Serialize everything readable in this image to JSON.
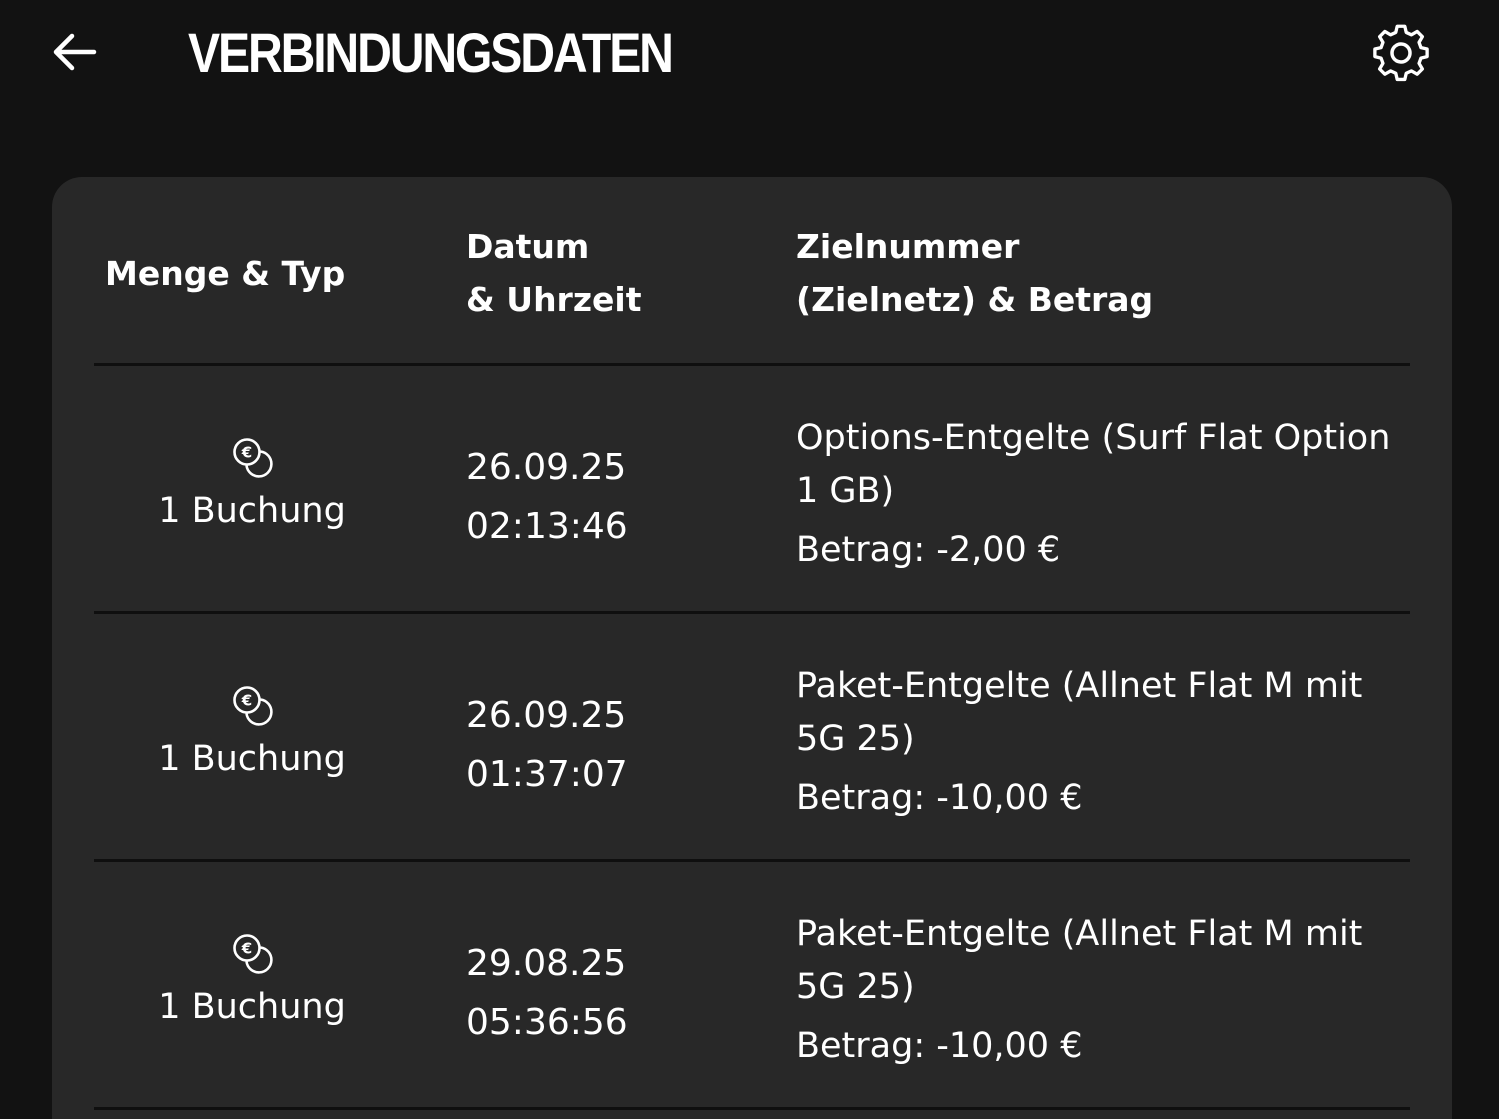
{
  "header": {
    "title": "VERBINDUNGSDATEN",
    "back_icon": "arrow-left-icon",
    "settings_icon": "gear-icon"
  },
  "table": {
    "columns": {
      "menge_typ": "Menge & Typ",
      "datum_line1": "Datum",
      "datum_line2": "& Uhrzeit",
      "ziel_line1": "Zielnummer",
      "ziel_line2": "(Zielnetz) & Betrag"
    },
    "rows": [
      {
        "type_icon": "euro-coins-icon",
        "type_label": "1 Buchung",
        "date": "26.09.25",
        "time": "02:13:46",
        "description": "Options-Entgelte (Surf Flat Option 1 GB)",
        "amount": "Betrag: -2,00 €"
      },
      {
        "type_icon": "euro-coins-icon",
        "type_label": "1 Buchung",
        "date": "26.09.25",
        "time": "01:37:07",
        "description": "Paket-Entgelte (Allnet Flat M mit 5G 25)",
        "amount": "Betrag: -10,00 €"
      },
      {
        "type_icon": "euro-coins-icon",
        "type_label": "1 Buchung",
        "date": "29.08.25",
        "time": "05:36:56",
        "description": "Paket-Entgelte (Allnet Flat M mit 5G 25)",
        "amount": "Betrag: -10,00 €"
      }
    ]
  },
  "colors": {
    "background": "#121212",
    "card": "#282828",
    "text": "#ffffff",
    "divider": "#0f0f0f"
  }
}
